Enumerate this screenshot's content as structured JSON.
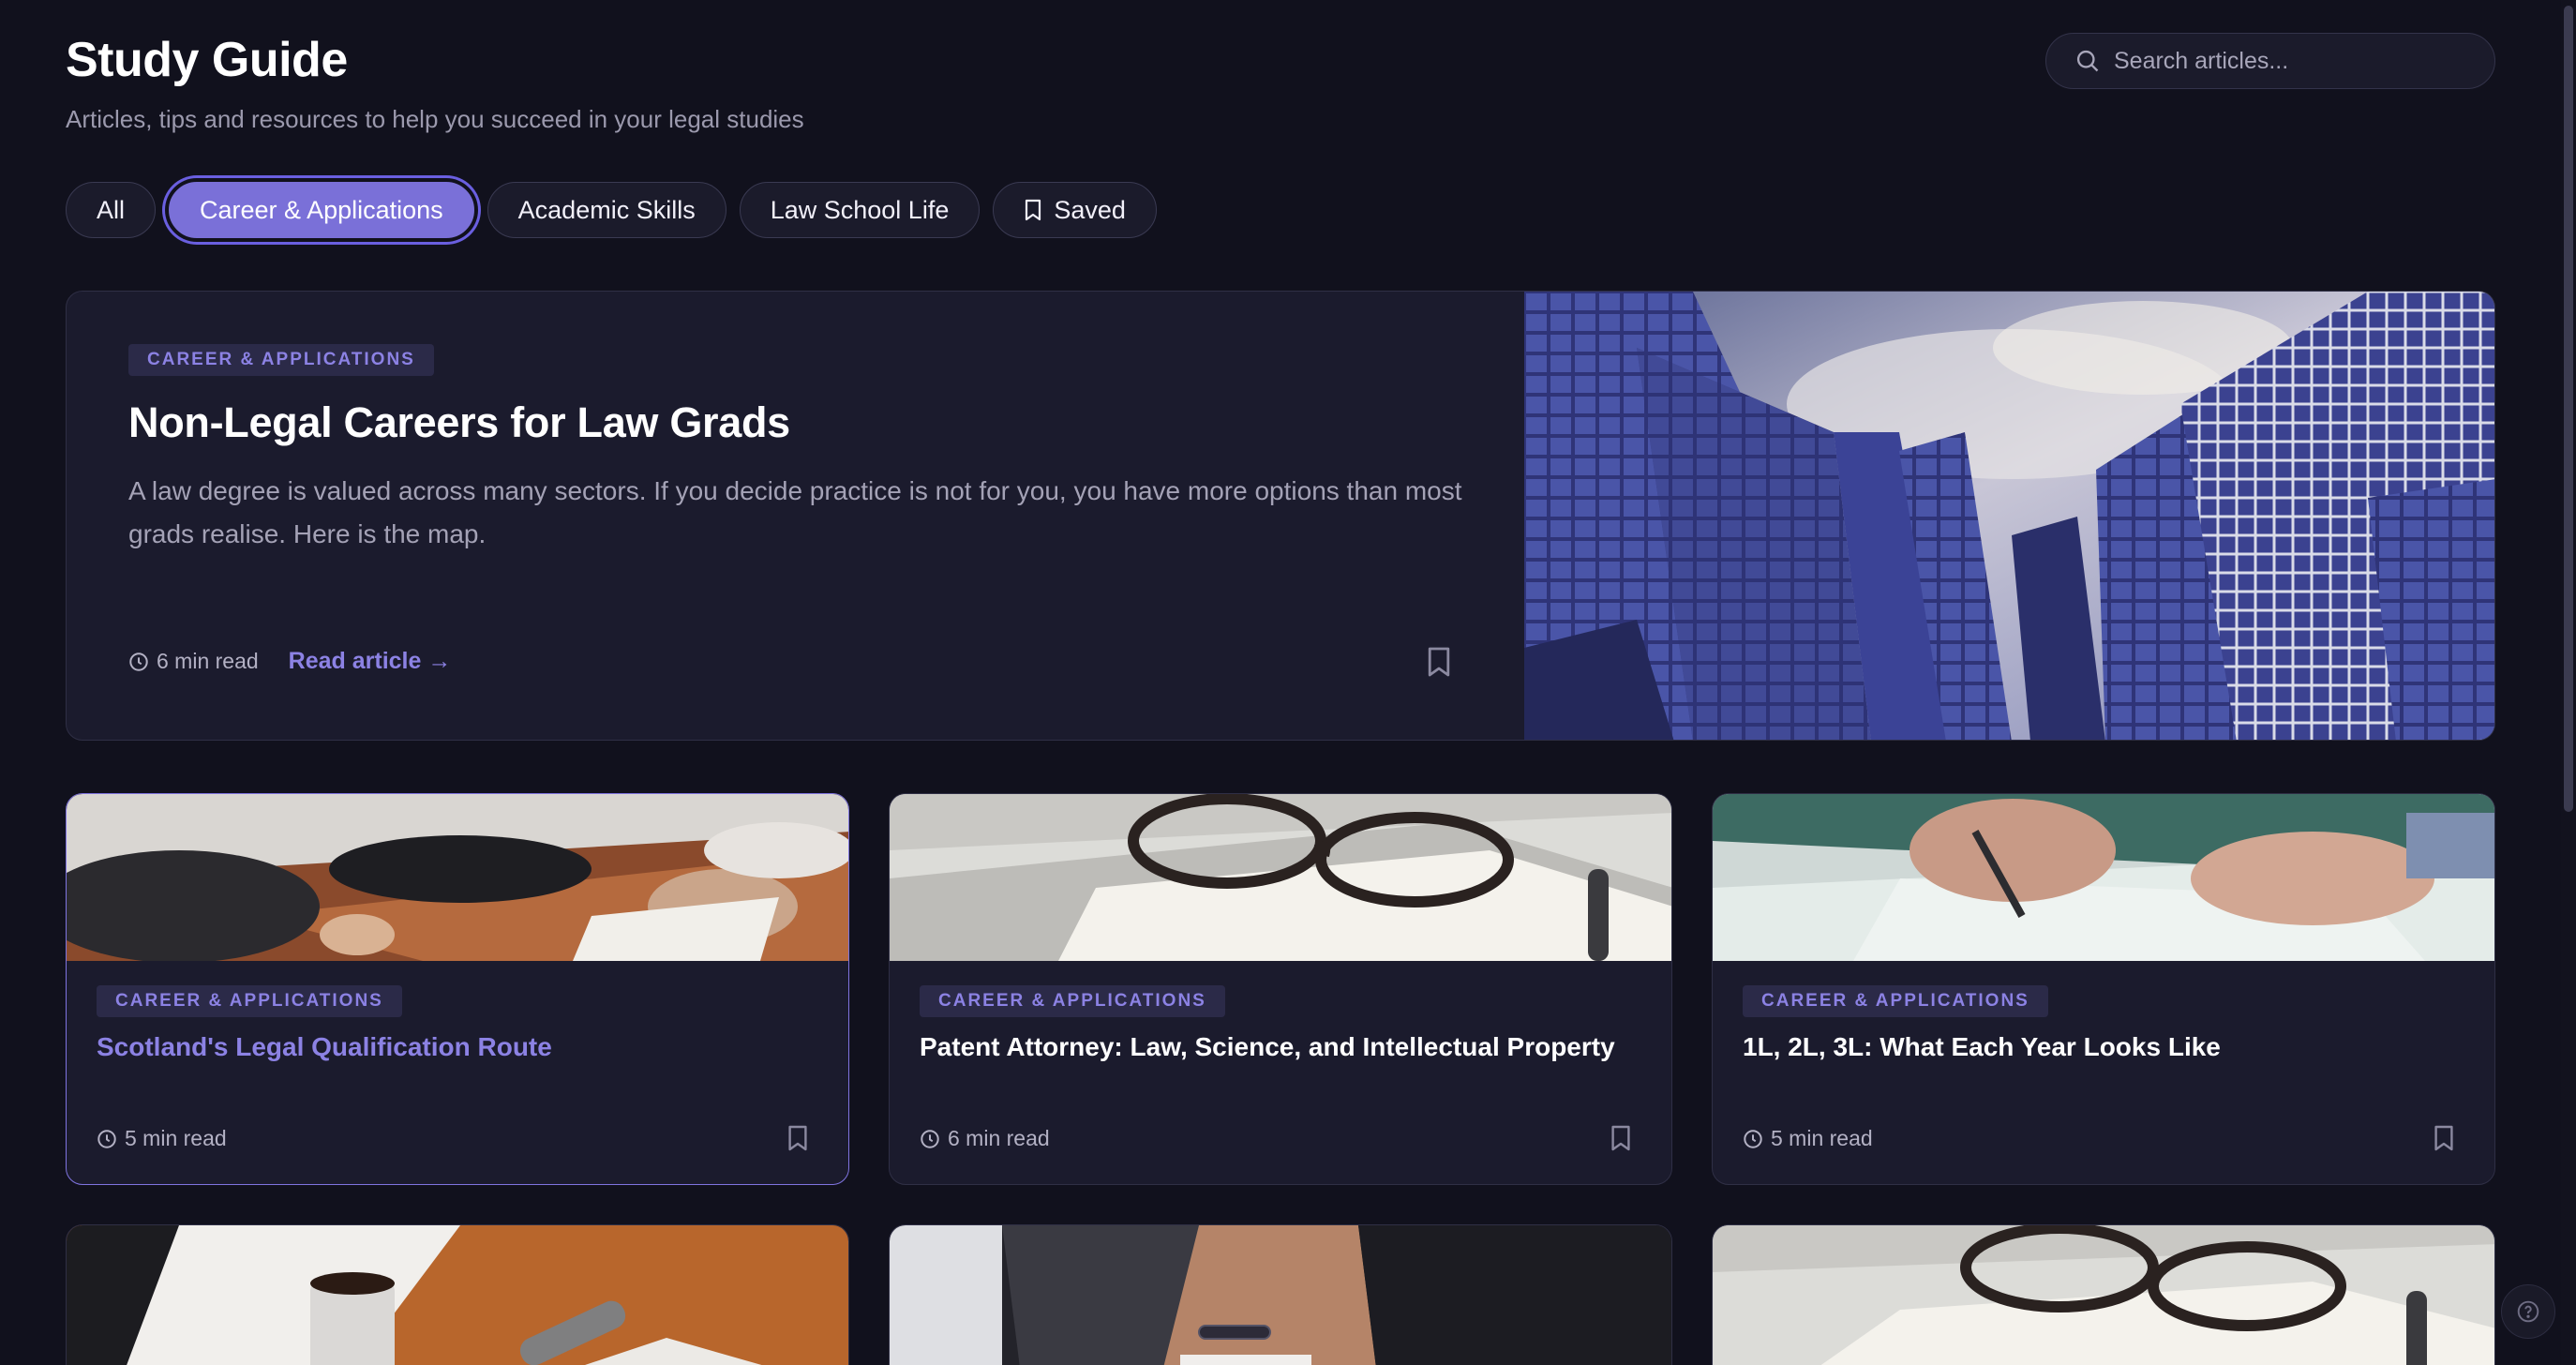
{
  "header": {
    "title": "Study Guide",
    "subtitle": "Articles, tips and resources to help you succeed in your legal studies",
    "search_placeholder": "Search articles..."
  },
  "tabs": [
    {
      "label": "All",
      "active": false
    },
    {
      "label": "Career & Applications",
      "active": true
    },
    {
      "label": "Academic Skills",
      "active": false
    },
    {
      "label": "Law School Life",
      "active": false
    },
    {
      "label": "Saved",
      "active": false,
      "icon": "bookmark-icon"
    }
  ],
  "featured": {
    "category": "CAREER & APPLICATIONS",
    "title": "Non-Legal Careers for Law Grads",
    "description": "A law degree is valued across many sectors. If you decide practice is not for you, you have more options than most grads realise. Here is the map.",
    "read_time": "6 min read",
    "read_link": "Read article →",
    "image": "glass-skyscrapers-photo"
  },
  "cards": [
    {
      "category": "CAREER & APPLICATIONS",
      "title": "Scotland's Legal Qualification Route",
      "read_time": "5 min read",
      "image": "meeting-table-photo",
      "highlighted": true
    },
    {
      "category": "CAREER & APPLICATIONS",
      "title": "Patent Attorney: Law, Science, and Intellectual Property",
      "read_time": "6 min read",
      "image": "glasses-notebook-photo",
      "highlighted": false
    },
    {
      "category": "CAREER & APPLICATIONS",
      "title": "1L, 2L, 3L: What Each Year Looks Like",
      "read_time": "5 min read",
      "image": "hand-writing-photo",
      "highlighted": false
    }
  ],
  "partial_cards": [
    {
      "image": "coffee-desk-photo"
    },
    {
      "image": "suit-wrist-photo"
    },
    {
      "image": "glasses-notebook-photo"
    }
  ],
  "colors": {
    "background": "#11111d",
    "card": "#1b1b2d",
    "accent": "#7a70d8",
    "accent_text": "#8c82e4",
    "muted_text": "#a4a2b6"
  }
}
